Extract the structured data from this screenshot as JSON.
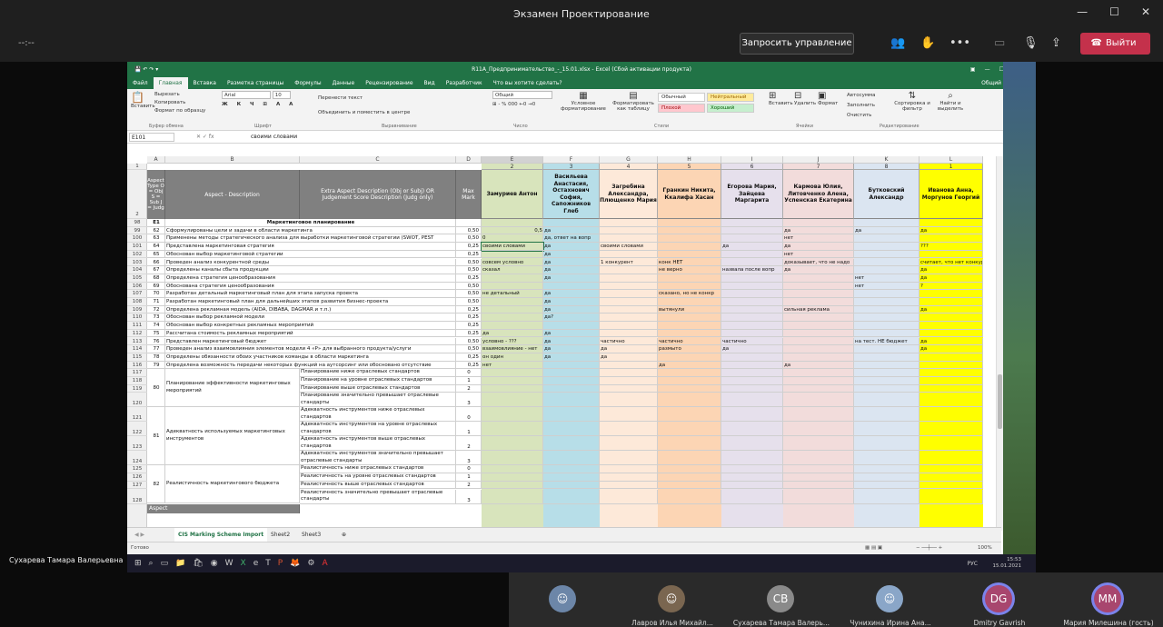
{
  "meeting": {
    "title": "Экзамен Проектирование",
    "timer": "--:--",
    "request_control": "Запросить управление",
    "leave": "Выйти",
    "presenter_name": "Сухарева Тамара Валерьевна"
  },
  "excel": {
    "title": "R11A_Предпринимательство_-_15.01.xlsx - Excel (Сбой активации продукта)",
    "tabs": [
      "Файл",
      "Главная",
      "Вставка",
      "Разметка страницы",
      "Формулы",
      "Данные",
      "Рецензирование",
      "Вид",
      "Разработчик",
      "Что вы хотите сделать?"
    ],
    "share": "Общий доступ",
    "ribbon": {
      "paste": "Вставить",
      "cut": "Вырезать",
      "copy": "Копировать",
      "format_painter": "Формат по образцу",
      "clipboard": "Буфер обмена",
      "font_name": "Arial",
      "font_size": "10",
      "font_group": "Шрифт",
      "wrap": "Перенести текст",
      "merge": "Объединить и поместить в центре",
      "align_group": "Выравнивание",
      "number_format": "Общий",
      "number_group": "Число",
      "cond_format": "Условное форматирование",
      "format_table": "Форматировать как таблицу",
      "style_normal": "Обычный",
      "style_neutral": "Нейтральный",
      "style_bad": "Плохой",
      "style_good": "Хороший",
      "styles_group": "Стили",
      "insert": "Вставить",
      "delete": "Удалить",
      "format": "Формат",
      "cells_group": "Ячейки",
      "autosum": "Автосумма",
      "fill": "Заполнить",
      "clear": "Очистить",
      "sort": "Сортировка и фильтр",
      "find": "Найти и выделить",
      "edit_group": "Редактирование"
    },
    "name_box": "E101",
    "formula_value": "своими словами",
    "columns": [
      "A",
      "B",
      "C",
      "D",
      "E",
      "F",
      "G",
      "H",
      "I",
      "J",
      "K",
      "L"
    ],
    "top_numbers": [
      "2",
      "3",
      "4",
      "5",
      "6",
      "7",
      "8",
      "1"
    ],
    "header": {
      "a": "Aspect Type O = Obj S = Sub J = Judg",
      "b": "Aspect - Description",
      "c": "Extra Aspect Description (Obj or Subj) OR Judgement Score Description (Judg only)",
      "d": "Max Mark"
    },
    "people": [
      "Замуриев Антон",
      "Васильева Анастасия, Остахнович София, Сапожников Глеб",
      "Загребина Александра, Плющенко Мария",
      "Гранкин Никита, Ккалифа Хасан",
      "Егорова Мария, Зайцева Маргарита",
      "Кармова Юлия, Литовченко Алена, Успенская Екатерина",
      "Бутковский Александр",
      "Иванова Анна, Моргунов Георгий"
    ],
    "rows": [
      {
        "r": "98",
        "a": "E1",
        "b": "Маркетинговое планирование",
        "c": "",
        "d": "",
        "v": [
          "",
          "",
          "",
          "",
          "",
          "",
          "",
          ""
        ]
      },
      {
        "r": "99",
        "a": "62",
        "b": "Сформулированы цели и задачи в области маркетинга",
        "c": "",
        "d": "0,50",
        "v": [
          "0,5",
          "да",
          "",
          "",
          "",
          "да",
          "да",
          "да"
        ]
      },
      {
        "r": "100",
        "a": "63",
        "b": "Применены методы стратегического анализа для выработки маркетинговой стратегии (SWOT, PEST",
        "c": "",
        "d": "0,50",
        "v": [
          "0",
          "да, ответ на вопр",
          "",
          "",
          "",
          "нет",
          "",
          ""
        ]
      },
      {
        "r": "101",
        "a": "64",
        "b": "Представлена маркетинговая стратегия",
        "c": "",
        "d": "0,25",
        "v": [
          "своими словами",
          "да",
          "своими словами",
          "",
          "да",
          "да",
          "",
          "???"
        ]
      },
      {
        "r": "102",
        "a": "65",
        "b": "Обоснован выбор маркетинговой стратегии",
        "c": "",
        "d": "0,25",
        "v": [
          "",
          "да",
          "",
          "",
          "",
          "нет",
          "",
          ""
        ]
      },
      {
        "r": "103",
        "a": "66",
        "b": "Проведен анализ конкурентной среды",
        "c": "",
        "d": "0,50",
        "v": [
          "совсем условно",
          "да",
          "1 конкурент",
          "конк НЕТ",
          "",
          "доказывает, что не надо",
          "",
          "считает, что нет конкуре"
        ]
      },
      {
        "r": "104",
        "a": "67",
        "b": "Определены каналы сбыта продукции",
        "c": "",
        "d": "0,50",
        "v": [
          "сказал",
          "да",
          "",
          "не верно",
          "назвала после вопр",
          "да",
          "",
          "да"
        ]
      },
      {
        "r": "105",
        "a": "68",
        "b": "Определена стратегия ценообразования",
        "c": "",
        "d": "0,25",
        "v": [
          "",
          "да",
          "",
          "",
          "",
          "",
          "нет",
          "да"
        ]
      },
      {
        "r": "106",
        "a": "69",
        "b": "Обоснована стратегия ценообразования",
        "c": "",
        "d": "0,50",
        "v": [
          "",
          "",
          "",
          "",
          "",
          "",
          "нет",
          "?"
        ]
      },
      {
        "r": "107",
        "a": "70",
        "b": "Разработан детальный маркетинговый план для этапа запуска проекта",
        "c": "",
        "d": "0,50",
        "v": [
          "не детальный",
          "да",
          "",
          "сказано, но не конкр",
          "",
          "",
          "",
          ""
        ]
      },
      {
        "r": "108",
        "a": "71",
        "b": "Разработан маркетинговый план для дальнейших этапов развития бизнес-проекта",
        "c": "",
        "d": "0,50",
        "v": [
          "",
          "да",
          "",
          "",
          "",
          "",
          "",
          ""
        ]
      },
      {
        "r": "109",
        "a": "72",
        "b": "Определена рекламная модель (AIDA, DIBABA, DAGMAR и т.п.)",
        "c": "",
        "d": "0,25",
        "v": [
          "",
          "да",
          "",
          "вытянули",
          "",
          "сильная реклама",
          "",
          "да"
        ]
      },
      {
        "r": "110",
        "a": "73",
        "b": "Обоснован выбор рекламной модели",
        "c": "",
        "d": "0,25",
        "v": [
          "",
          "да?",
          "",
          "",
          "",
          "",
          "",
          ""
        ]
      },
      {
        "r": "111",
        "a": "74",
        "b": "Обоснован выбор конкретных рекламных мероприятий",
        "c": "",
        "d": "0,25",
        "v": [
          "",
          "",
          "",
          "",
          "",
          "",
          "",
          ""
        ]
      },
      {
        "r": "112",
        "a": "75",
        "b": "Рассчитана стоимость рекламных мероприятий",
        "c": "",
        "d": "0,25",
        "v": [
          "да",
          "да",
          "",
          "",
          "",
          "",
          "",
          ""
        ]
      },
      {
        "r": "113",
        "a": "76",
        "b": "Представлен маркетинговый бюджет",
        "c": "",
        "d": "0,50",
        "v": [
          "условно - ???",
          "да",
          "частично",
          "частично",
          "частично",
          "",
          "на тест. НЕ бюджет",
          "да"
        ]
      },
      {
        "r": "114",
        "a": "77",
        "b": "Проведен анализ взаимовлияния элементов модели 4 «P» для выбранного продукта/услуги",
        "c": "",
        "d": "0,50",
        "v": [
          "взаимовлияние - нет",
          "да",
          "да",
          "размыто",
          "да",
          "",
          "",
          "да"
        ]
      },
      {
        "r": "115",
        "a": "78",
        "b": "Определены обязанности обоих участников команды в области маркетинга",
        "c": "",
        "d": "0,25",
        "v": [
          "он один",
          "да",
          "да",
          "",
          "",
          "",
          "",
          ""
        ]
      },
      {
        "r": "116",
        "a": "79",
        "b": "Определена возможность передачи некоторых функций на аутсорсинг или обосновано отсутствие",
        "c": "",
        "d": "0,25",
        "v": [
          "нет",
          "",
          "",
          "да",
          "",
          "да",
          "",
          ""
        ]
      }
    ],
    "judg_rows": [
      {
        "r": "117",
        "c": "Планирование ниже отраслевых стандартов",
        "d": "0"
      },
      {
        "r": "118",
        "c": "Планирование на уровне отраслевых стандартов",
        "d": "1"
      },
      {
        "r": "119",
        "c": "Планирование выше отраслевых стандартов",
        "d": "2"
      },
      {
        "r": "120",
        "c": "Планирование значительно превышает отраслевые стандарты",
        "d": "3"
      },
      {
        "r": "121",
        "c": "Адекватность инструментов ниже отраслевых стандартов",
        "d": "0"
      },
      {
        "r": "122",
        "c": "Адекватность инструментов на уровне отраслевых стандартов",
        "d": "1"
      },
      {
        "r": "123",
        "c": "Адекватность инструментов выше отраслевых стандартов",
        "d": "2"
      },
      {
        "r": "124",
        "c": "Адекватность инструментов значительно превышает отраслевые стандарты",
        "d": "3"
      },
      {
        "r": "125",
        "c": "Реалистичность ниже отраслевых стандартов",
        "d": "0"
      },
      {
        "r": "126",
        "c": "Реалистичность на уровне отраслевых стандартов",
        "d": "1"
      },
      {
        "r": "127",
        "c": "Реалистичность выше отраслевых стандартов",
        "d": "2"
      },
      {
        "r": "128",
        "c": "Реалистичность значительно превышает отраслевые стандарты",
        "d": "3"
      }
    ],
    "groups": [
      {
        "a": "80",
        "b": "Планирование эффективности маркетинговых мероприятий"
      },
      {
        "a": "81",
        "b": "Адекватность используемых маркетинговых инструментов"
      },
      {
        "a": "82",
        "b": "Реалистичность маркетингового бюджета"
      }
    ],
    "last_row": "Aspect",
    "sheets": [
      "CIS Marking Scheme Import",
      "Sheet2",
      "Sheet3"
    ],
    "status_ready": "Готово",
    "zoom": "100%"
  },
  "taskbar": {
    "time": "15:53",
    "date": "15.01.2021",
    "lang": "РУС"
  },
  "participants": [
    {
      "name": "",
      "initials": ""
    },
    {
      "name": "Лавров Илья Михайл...",
      "initials": ""
    },
    {
      "name": "Сухарева Тамара Валерь...",
      "initials": "СВ"
    },
    {
      "name": "Чунихина Ирина Ана...",
      "initials": ""
    },
    {
      "name": "Dmitry Gavrish",
      "initials": "DG"
    },
    {
      "name": "Мария Милешина (гость)",
      "initials": "ММ"
    }
  ],
  "colors": {
    "teams_red": "#c4314b",
    "excel_green": "#217346",
    "col_e": "#d8e4bc",
    "col_f": "#b7dee8",
    "col_g": "#fde9d9",
    "col_h": "#fcd5b4",
    "col_i": "#e6e0ec",
    "col_j": "#f2dcdb",
    "col_k": "#dbe5f1",
    "col_l": "#ffff00"
  }
}
